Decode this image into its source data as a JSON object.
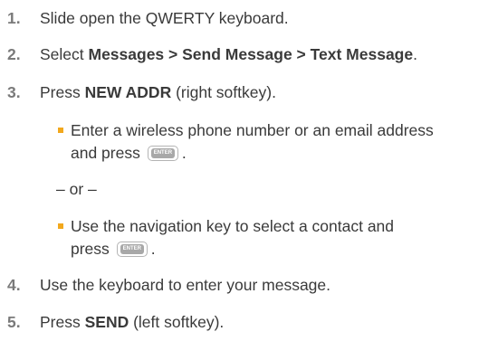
{
  "steps": [
    {
      "num": "1.",
      "text": "Slide open the QWERTY keyboard."
    },
    {
      "num": "2.",
      "pre": "Select ",
      "bold": "Messages > Send Message > Text Message",
      "post": "."
    },
    {
      "num": "3.",
      "pre": "Press ",
      "bold": "NEW ADDR",
      "post": " (right softkey)."
    },
    {
      "num": "4.",
      "text": "Use the keyboard to enter your message."
    },
    {
      "num": "5.",
      "pre": "Press ",
      "bold": "SEND",
      "post": " (left softkey)."
    }
  ],
  "sub_a": {
    "line1": "Enter a wireless phone number or an email address",
    "line2": "and press",
    "end": "."
  },
  "or_text": "– or –",
  "sub_b": {
    "line1": "Use the navigation key to select a contact and",
    "line2": "press",
    "end": "."
  },
  "enter_key": {
    "label": "ENTER"
  },
  "colors": {
    "text": "#3a3a3a",
    "number": "#7a7a7a",
    "bullet": "#f2a81d"
  }
}
